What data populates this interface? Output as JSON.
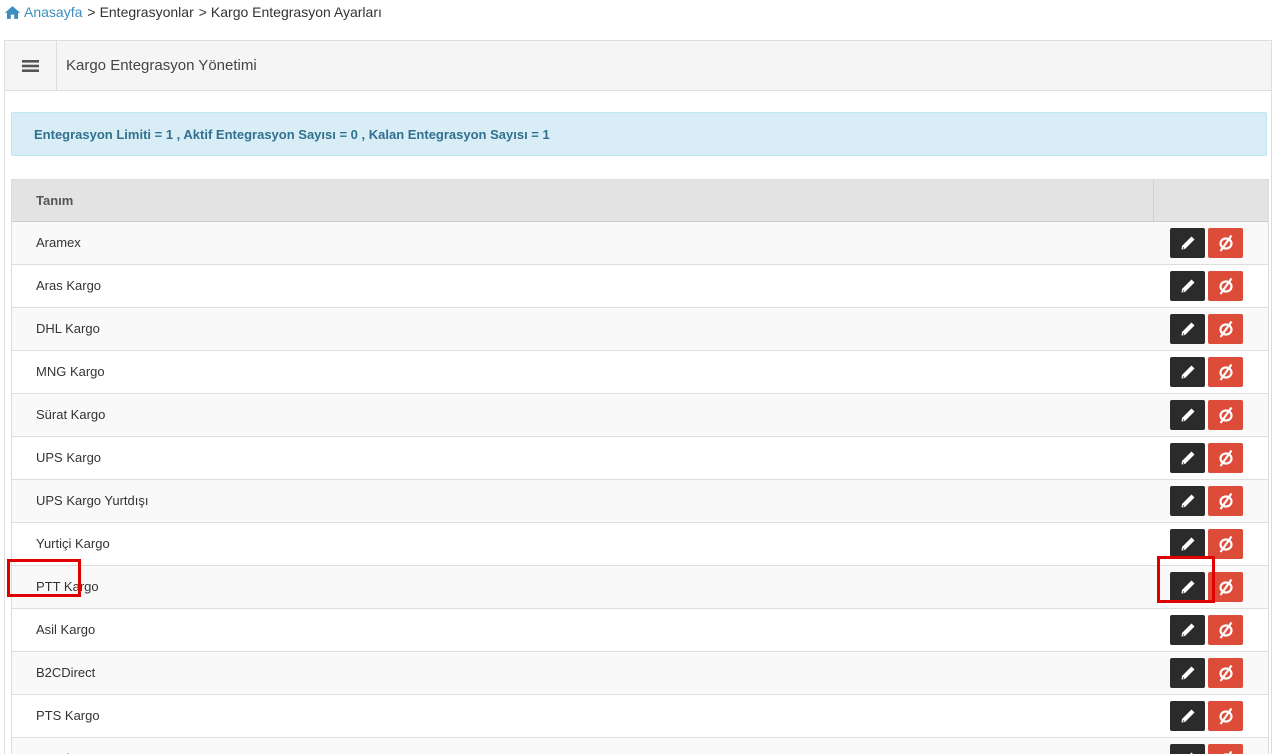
{
  "breadcrumb": {
    "home": "Anasayfa",
    "separator": ">",
    "level1": "Entegrasyonlar",
    "level2": "Kargo Entegrasyon Ayarları"
  },
  "panel": {
    "title": "Kargo Entegrasyon Yönetimi",
    "toggle_icon": "hamburger-menu-icon"
  },
  "alert": {
    "text": "Entegrasyon Limiti = 1 , Aktif Entegrasyon Sayısı = 0 , Kalan Entegrasyon Sayısı = 1"
  },
  "table": {
    "header_name": "Tanım",
    "header_actions": "",
    "rows": [
      {
        "name": "Aramex"
      },
      {
        "name": "Aras Kargo"
      },
      {
        "name": "DHL Kargo"
      },
      {
        "name": "MNG Kargo"
      },
      {
        "name": "Sürat Kargo"
      },
      {
        "name": "UPS Kargo"
      },
      {
        "name": "UPS Kargo Yurtdışı"
      },
      {
        "name": "Yurtiçi Kargo"
      },
      {
        "name": "PTT Kargo"
      },
      {
        "name": "Asil Kargo"
      },
      {
        "name": "B2CDirect"
      },
      {
        "name": "PTS Kargo"
      },
      {
        "name": "HepsiExpress Kargo"
      }
    ]
  },
  "icons": {
    "edit": "pencil-icon",
    "hide": "eye-slash-icon"
  },
  "colors": {
    "link": "#3c8dbc",
    "alert_bg": "#d9edf7",
    "edit_button": "#2b2b2b",
    "hide_button": "#dd4b39",
    "highlight": "#e00000"
  }
}
